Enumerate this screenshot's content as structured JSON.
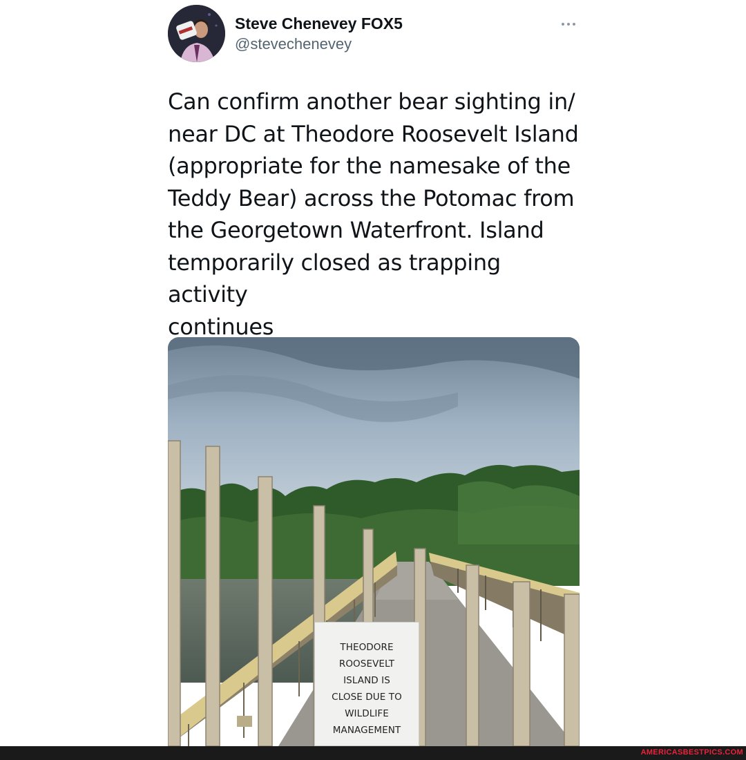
{
  "tweet": {
    "display_name": "Steve Chenevey FOX5",
    "handle": "@stevechenevey",
    "text": "Can confirm another bear sighting in/\nnear DC at Theodore Roosevelt Island\n(appropriate for the namesake of the\nTeddy Bear) across the Potomac from\nthe Georgetown Waterfront. Island\ntemporarily closed as trapping activity\ncontinues",
    "more_icon": "more-horizontal-icon"
  },
  "photo": {
    "sign_lines": [
      "THEODORE",
      "ROOSEVELT",
      "ISLAND IS",
      "CLOSE DUE TO",
      "WILDLIFE",
      "MANAGEMENT"
    ]
  },
  "footer": {
    "watermark": "AMERICASBESTPICS.COM",
    "watermark_color": "#e8233b"
  }
}
